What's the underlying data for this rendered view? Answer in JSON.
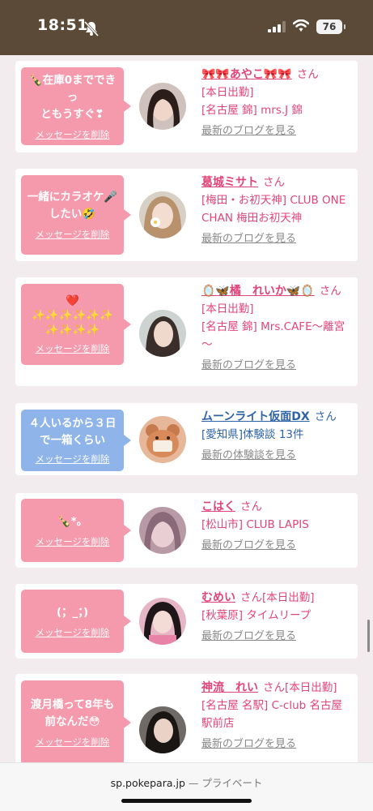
{
  "status_bar": {
    "time": "18:51",
    "battery": "76"
  },
  "browser": {
    "domain": "sp.pokepara.jp",
    "mode": "— プライベート"
  },
  "items": [
    {
      "message": "🍾在庫0までできっ\nともうすぐ❣",
      "delete_label": "メッセージを削除",
      "name": "🎀🎀あやこ🎀🎀",
      "honorific": "さん",
      "lines": [
        "[本日出勤]",
        "[名古屋 錦] mrs.J 錦"
      ],
      "link": "最新のブログを見る",
      "type": "cast"
    },
    {
      "message": "一緒にカラオケ🎤\nしたい🤣",
      "delete_label": "メッセージを削除",
      "name": "葛城ミサト",
      "honorific": "さん",
      "lines": [
        "[梅田・お初天神] CLUB ONE CHAN 梅田お初天神"
      ],
      "link": "最新のブログを見る",
      "type": "cast"
    },
    {
      "message": "❤️\n✨✨✨✨✨✨\n✨✨✨✨",
      "delete_label": "メッセージを削除",
      "name": "🪞🦋橘　れいか🦋🪞",
      "honorific": "さん",
      "lines": [
        "[本日出勤]",
        "[名古屋 錦] Mrs.CAFE～離宮～"
      ],
      "link": "最新のブログを見る",
      "type": "cast"
    },
    {
      "message": "４人いるから３日\nで一箱くらい",
      "delete_label": "メッセージを削除",
      "name": "ムーンライト仮面DX",
      "honorific": "さん",
      "lines": [
        "[愛知県]体験談 13件"
      ],
      "link": "最新の体験談を見る",
      "type": "user"
    },
    {
      "message": "🍾*。",
      "delete_label": "メッセージを削除",
      "name": "こはく",
      "honorific": "さん",
      "lines": [
        "[松山市] CLUB LAPIS"
      ],
      "link": "最新のブログを見る",
      "type": "cast"
    },
    {
      "message": "(；_；)",
      "delete_label": "メッセージを削除",
      "name": "むめい",
      "honorific": "さん",
      "lines": [
        "[本日出勤]",
        "[秋葉原] タイムリープ"
      ],
      "link": "最新のブログを見る",
      "type": "cast"
    },
    {
      "message": "渡月橋って8年も\n前なんだ😳",
      "delete_label": "メッセージを削除",
      "name": "神流　れい",
      "honorific": "さん",
      "lines": [
        "[本日出勤]",
        "[名古屋 名駅] C-club 名古屋駅前店"
      ],
      "link": "最新のブログを見る",
      "type": "cast"
    }
  ],
  "colors": {
    "pink_bubble": "#f59aad",
    "blue_bubble": "#8fb4ea",
    "name_pink": "#e0457a",
    "name_blue": "#2f63a8"
  }
}
